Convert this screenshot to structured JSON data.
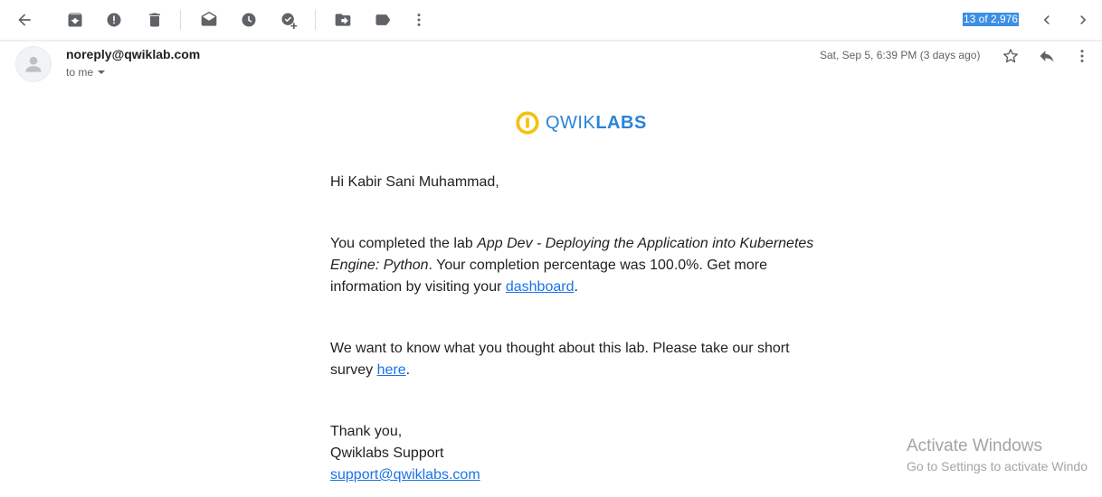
{
  "toolbar": {
    "icons": [
      "back-arrow-icon",
      "archive-icon",
      "report-spam-icon",
      "delete-icon",
      "mark-unread-icon",
      "snooze-icon",
      "add-to-tasks-icon",
      "move-to-icon",
      "label-icon",
      "more-vert-icon"
    ],
    "counter": "13 of 2,976",
    "nav": [
      "chevron-left-icon",
      "chevron-right-icon"
    ]
  },
  "message": {
    "sender": "noreply@qwiklab.com",
    "recipient": "to me",
    "date": "Sat, Sep 5, 6:39 PM (3 days ago)"
  },
  "logo": {
    "part1": "QWIK",
    "part2": "LABS",
    "icon_color": "#f4c20d",
    "text_color": "#2a83d9"
  },
  "email_body": {
    "greeting": "Hi Kabir Sani Muhammad,",
    "p1_before": "You completed the lab ",
    "p1_lab": "App Dev - Deploying the Application into Kubernetes Engine: Python",
    "p1_after": ". Your completion percentage was 100.0%. Get more information by visiting your ",
    "p1_link": "dashboard",
    "p1_end": ".",
    "p2_before": "We want to know what you thought about this lab. Please take our short survey ",
    "p2_link": "here",
    "p2_end": ".",
    "closing": "Thank you,",
    "signature": "Qwiklabs Support",
    "support_email": "support@qwiklabs.com"
  },
  "watermark": {
    "title": "Activate Windows",
    "subtitle": "Go to Settings to activate Windo"
  },
  "colors": {
    "link": "#1a73e8",
    "accent_counter": "#3c8ee6",
    "icon": "#5f6368"
  }
}
